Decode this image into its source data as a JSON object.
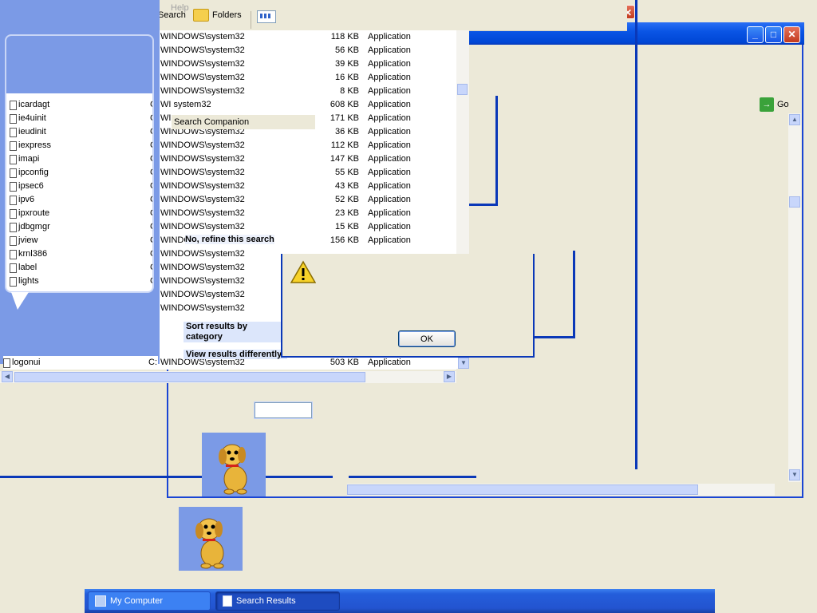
{
  "toolbar": {
    "menu_help": "Help",
    "search_label": "Search",
    "folders_label": "Folders"
  },
  "files": [
    {
      "path": "WINDOWS\\system32",
      "size": "118 KB",
      "type": "Application"
    },
    {
      "path": "WINDOWS\\system32",
      "size": "56 KB",
      "type": "Application"
    },
    {
      "path": "WINDOWS\\system32",
      "size": "39 KB",
      "type": "Application"
    },
    {
      "path": "WINDOWS\\system32",
      "size": "16 KB",
      "type": "Application"
    },
    {
      "path": "WINDOWS\\system32",
      "size": "8 KB",
      "type": "Application"
    },
    {
      "path": "WI        system32",
      "size": "608 KB",
      "type": "Application"
    },
    {
      "path": "WI",
      "size": "171 KB",
      "type": "Application"
    },
    {
      "path": "WINDOWS\\system32",
      "size": "36 KB",
      "type": "Application"
    },
    {
      "path": "WINDOWS\\system32",
      "size": "112 KB",
      "type": "Application"
    },
    {
      "path": "WINDOWS\\system32",
      "size": "147 KB",
      "type": "Application"
    },
    {
      "path": "WINDOWS\\system32",
      "size": "55 KB",
      "type": "Application"
    },
    {
      "path": "WINDOWS\\system32",
      "size": "43 KB",
      "type": "Application"
    },
    {
      "path": "WINDOWS\\system32",
      "size": "52 KB",
      "type": "Application"
    },
    {
      "path": "WINDOWS\\system32",
      "size": "23 KB",
      "type": "Application"
    },
    {
      "path": "WINDOWS\\system32",
      "size": "15 KB",
      "type": "Application"
    },
    {
      "path": "WINDO",
      "size": "156 KB",
      "type": "Application"
    },
    {
      "path": "WINDOWS\\system32",
      "size": "",
      "type": ""
    },
    {
      "path": "WINDOWS\\system32",
      "size": "",
      "type": ""
    },
    {
      "path": "WINDOWS\\system32",
      "size": "",
      "type": ""
    },
    {
      "path": "WINDOWS\\system32",
      "size": "",
      "type": ""
    },
    {
      "path": "WINDOWS\\system32",
      "size": "",
      "type": ""
    }
  ],
  "last_row": {
    "path": "WINDOWS\\system32",
    "size": "503 KB",
    "type": "Application"
  },
  "balloon_items": [
    {
      "name": "icardagt",
      "col": "C"
    },
    {
      "name": "ie4uinit",
      "col": "C"
    },
    {
      "name": "ieudinit",
      "col": "C"
    },
    {
      "name": "iexpress",
      "col": "C"
    },
    {
      "name": "imapi",
      "col": "C"
    },
    {
      "name": "ipconfig",
      "col": "C"
    },
    {
      "name": "ipsec6",
      "col": "C"
    },
    {
      "name": "ipv6",
      "col": "C"
    },
    {
      "name": "ipxroute",
      "col": "C"
    },
    {
      "name": "jdbgmgr",
      "col": "C"
    },
    {
      "name": "jview",
      "col": "C"
    },
    {
      "name": "krnl386",
      "col": "C"
    },
    {
      "name": "label",
      "col": "C"
    },
    {
      "name": "lights",
      "col": "C"
    }
  ],
  "bottom_item": {
    "name": "logonui",
    "col": "C:"
  },
  "companion": {
    "title": "Search Companion",
    "refine": "No, refine this search",
    "sort": "Sort results by category",
    "view": "View results differently"
  },
  "dialog": {
    "ok_label": "OK"
  },
  "address": {
    "go_label": "Go"
  },
  "taskbar": {
    "items": [
      {
        "label": "My Computer"
      },
      {
        "label": "Search Results"
      }
    ]
  },
  "colors": {
    "accent": "#0a38b8",
    "desktop": "#ece9d8",
    "balloon": "#7b9ae6",
    "taskbar": "#245edb"
  }
}
